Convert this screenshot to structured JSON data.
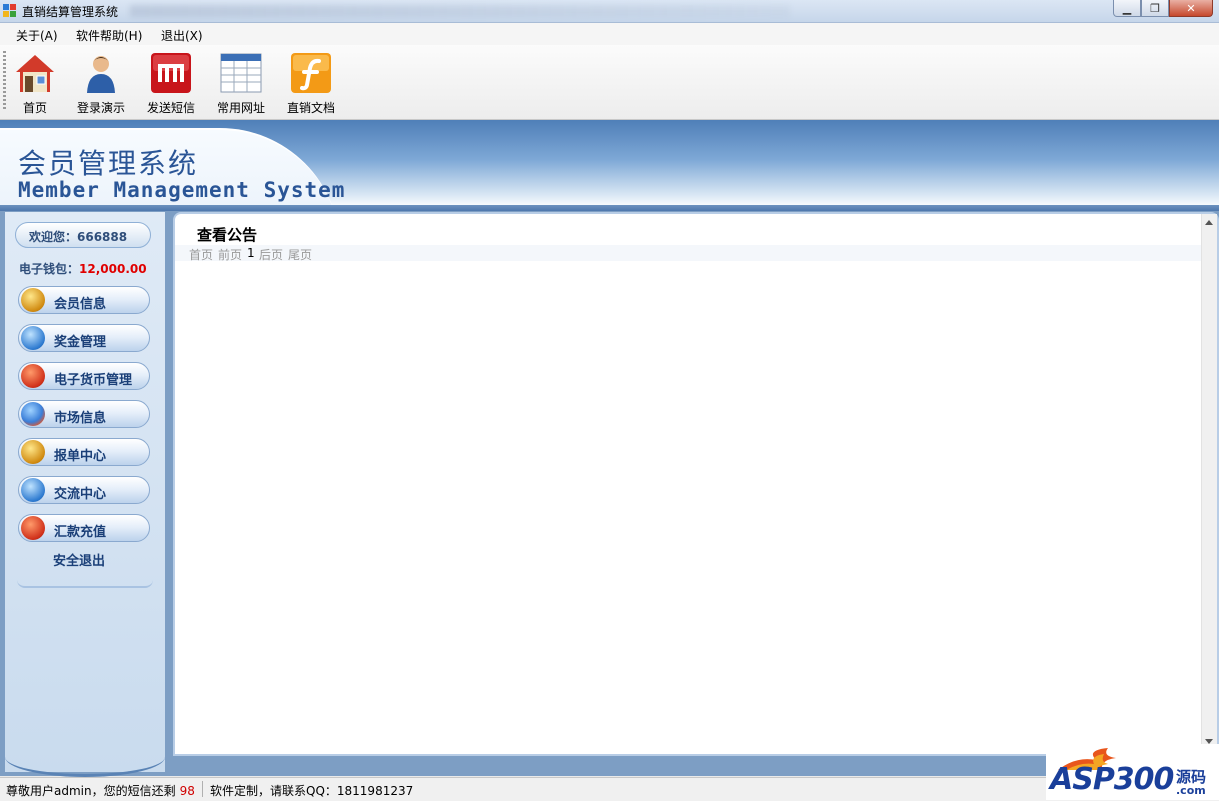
{
  "window": {
    "title": "直销结算管理系统"
  },
  "menu": [
    {
      "label": "关于(A)"
    },
    {
      "label": "软件帮助(H)"
    },
    {
      "label": "退出(X)"
    }
  ],
  "toolbar": [
    {
      "label": "首页",
      "icon": "house-icon"
    },
    {
      "label": "登录演示",
      "icon": "user-icon"
    },
    {
      "label": "发送短信",
      "icon": "message-icon"
    },
    {
      "label": "常用网址",
      "icon": "table-icon"
    },
    {
      "label": "直销文档",
      "icon": "flash-document-icon"
    }
  ],
  "banner": {
    "title_cn": "会员管理系统",
    "title_en": "Member Management System"
  },
  "sidebar": {
    "welcome_label": "欢迎您：666888",
    "wallet_label": "电子钱包：",
    "wallet_amount": "12,000.00",
    "items": [
      {
        "label": "会员信息",
        "icon": "globe-stripes-icon"
      },
      {
        "label": "奖金管理",
        "icon": "ie-icon"
      },
      {
        "label": "电子货币管理",
        "icon": "runner-icon"
      },
      {
        "label": "市场信息",
        "icon": "windows-globe-icon"
      },
      {
        "label": "报单中心",
        "icon": "globe-stripes-icon"
      },
      {
        "label": "交流中心",
        "icon": "ie-icon"
      },
      {
        "label": "汇款充值",
        "icon": "runner-icon"
      }
    ],
    "logout_label": "安全退出"
  },
  "content": {
    "title": "查看公告",
    "pager": {
      "first": "首页",
      "prev": "前页",
      "current": "1",
      "next": "后页",
      "last": "尾页"
    }
  },
  "status": {
    "sms_text": "尊敬用户admin，您的短信还剩",
    "sms_count": "98",
    "contact_text": "软件定制，请联系QQ：1811981237"
  },
  "watermark": {
    "brand": "ASP300",
    "cn": "源码",
    "domain": ".com"
  },
  "colors": {
    "accent": "#2a5596",
    "wallet_amount": "#e00000",
    "sms_count": "#d00000"
  }
}
